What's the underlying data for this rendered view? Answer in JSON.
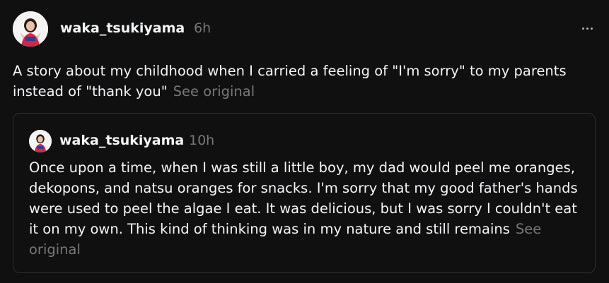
{
  "post": {
    "username": "waka_tsukiyama",
    "time": "6h",
    "text": "A story about my childhood when I carried a feeling of \"I'm sorry\" to my parents instead of \"thank you\"",
    "see_original": "See original",
    "more_icon": "more-horizontal-icon"
  },
  "quoted_post": {
    "username": "waka_tsukiyama",
    "time": "10h",
    "text": "Once upon a time, when I was still a little boy, my dad would peel me oranges, dekopons, and natsu oranges for snacks. I'm sorry that my good father's hands were used to peel the algae I eat. It was delicious, but I was sorry I couldn't eat it on my own. This kind of thinking was in my nature and still remains",
    "see_original": "See original"
  },
  "colors": {
    "background": "#101010",
    "primary_text": "#f3f5f7",
    "secondary_text": "#777777",
    "border": "#2e2e2e"
  }
}
